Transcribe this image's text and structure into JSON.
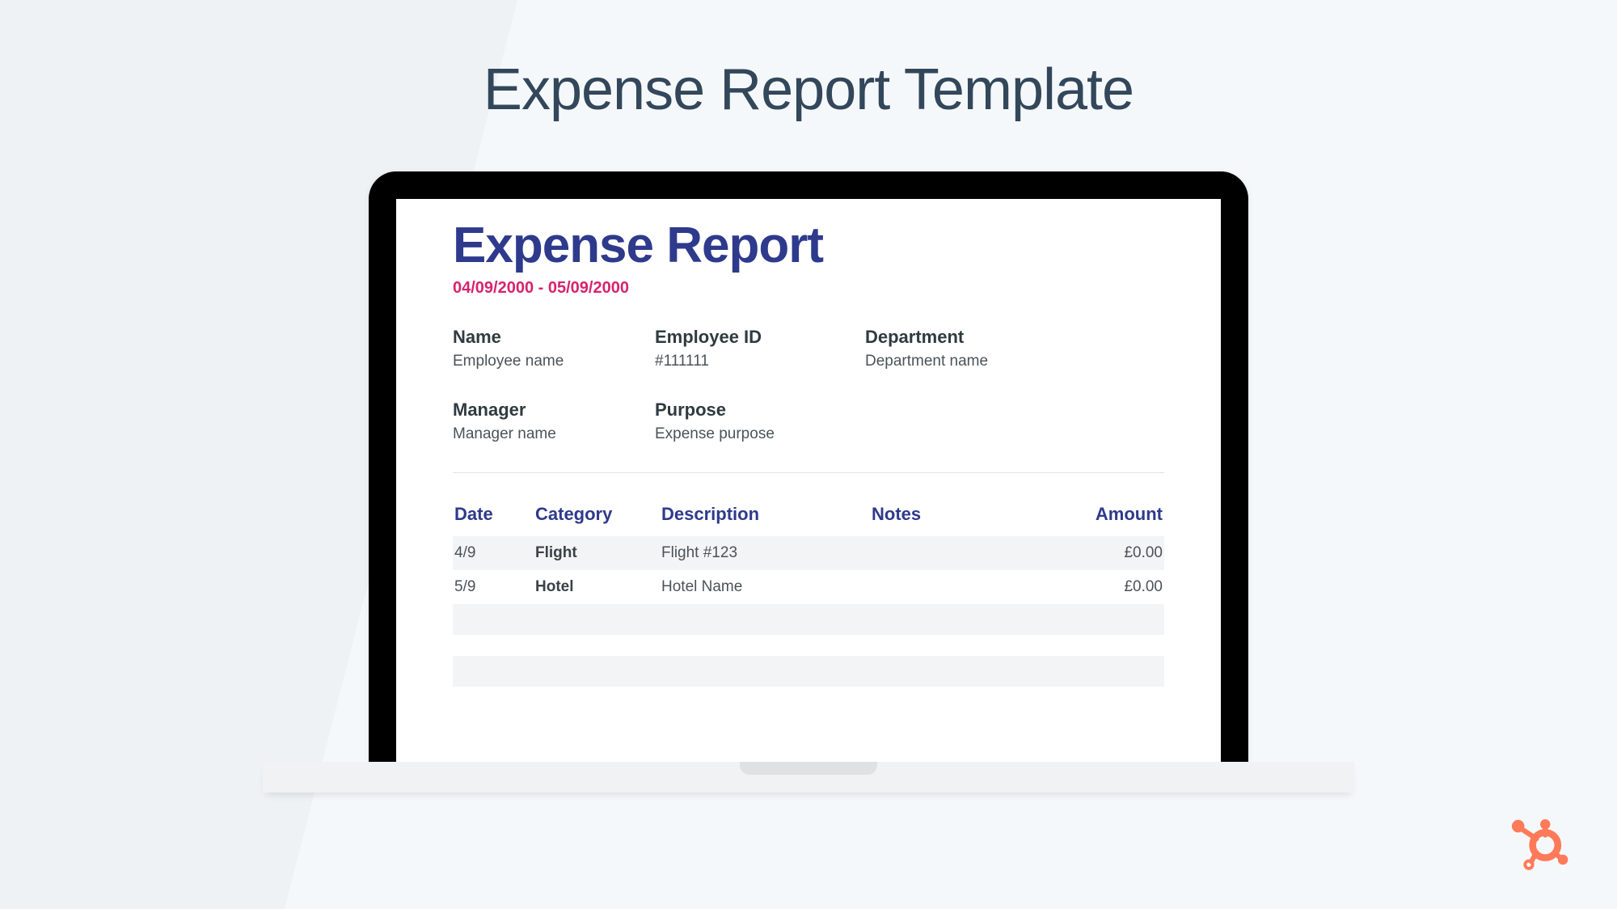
{
  "page": {
    "title": "Expense Report Template"
  },
  "report": {
    "title": "Expense Report",
    "date_range": "04/09/2000 - 05/09/2000",
    "fields": {
      "name": {
        "label": "Name",
        "value": "Employee name"
      },
      "employee_id": {
        "label": "Employee ID",
        "value": "#111111"
      },
      "department": {
        "label": "Department",
        "value": "Department name"
      },
      "manager": {
        "label": "Manager",
        "value": "Manager name"
      },
      "purpose": {
        "label": "Purpose",
        "value": "Expense purpose"
      }
    },
    "columns": {
      "date": "Date",
      "category": "Category",
      "description": "Description",
      "notes": "Notes",
      "amount": "Amount"
    },
    "rows": [
      {
        "date": "4/9",
        "category": "Flight",
        "description": "Flight #123",
        "notes": "",
        "amount": "£0.00"
      },
      {
        "date": "5/9",
        "category": "Hotel",
        "description": "Hotel Name",
        "notes": "",
        "amount": "£0.00"
      }
    ]
  },
  "brand": {
    "logo_name": "hubspot-sprocket"
  }
}
